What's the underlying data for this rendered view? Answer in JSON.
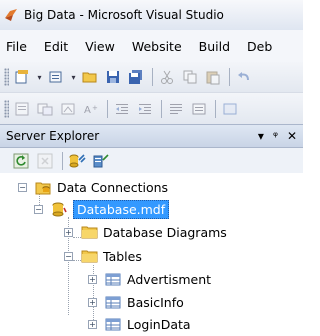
{
  "window": {
    "title": "Big Data - Microsoft Visual Studio"
  },
  "menu": {
    "items": [
      {
        "label": "File"
      },
      {
        "label": "Edit"
      },
      {
        "label": "View"
      },
      {
        "label": "Website"
      },
      {
        "label": "Build"
      },
      {
        "label": "Deb"
      }
    ]
  },
  "server_explorer": {
    "title": "Server Explorer",
    "pin_glyph": "▾",
    "autohide_glyph": "ᵠ",
    "close_glyph": "✕"
  },
  "tree": {
    "root": {
      "label": "Data Connections",
      "expander": "−"
    },
    "database": {
      "label": "Database.mdf",
      "expander": "−"
    },
    "diagrams": {
      "label": "Database Diagrams",
      "expander": "+"
    },
    "tables": {
      "label": "Tables",
      "expander": "−"
    },
    "table_items": [
      {
        "label": "Advertisment",
        "expander": "+"
      },
      {
        "label": "BasicInfo",
        "expander": "+"
      },
      {
        "label": "LoginData",
        "expander": "+"
      }
    ]
  },
  "icons": {
    "app": "visual-studio-icon",
    "refresh": "refresh-icon",
    "stop": "stop-icon",
    "connect_db": "connect-to-database-icon",
    "connect_server": "connect-to-server-icon",
    "folder": "folder-icon",
    "database": "database-icon",
    "table": "table-icon"
  }
}
